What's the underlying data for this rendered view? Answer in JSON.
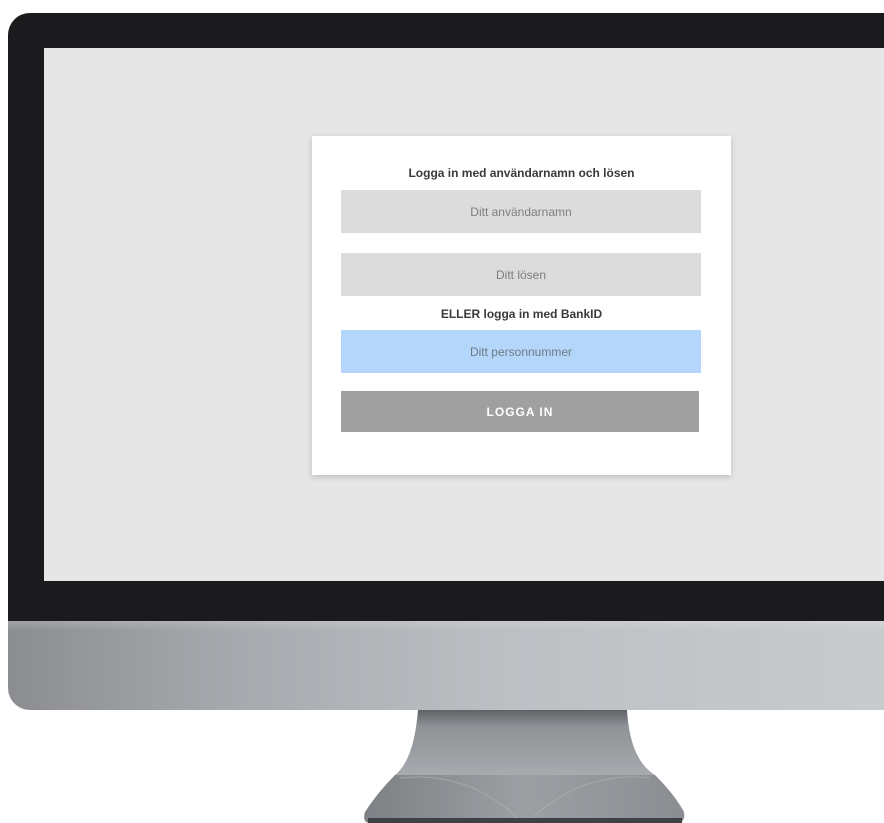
{
  "login": {
    "heading_credentials": "Logga in med användarnamn och lösen",
    "username_placeholder": "Ditt användarnamn",
    "password_placeholder": "Ditt lösen",
    "heading_bankid": "ELLER logga in med BankID",
    "personnummer_placeholder": "Ditt personnummer",
    "submit_label": "LOGGA IN"
  },
  "colors": {
    "screen_background": "#e6e6e6",
    "card_background": "#ffffff",
    "input_gray": "#dcdcdc",
    "input_blue": "#b3d6fa",
    "button_gray": "#a0a0a0",
    "bezel": "#1b1a1d"
  }
}
